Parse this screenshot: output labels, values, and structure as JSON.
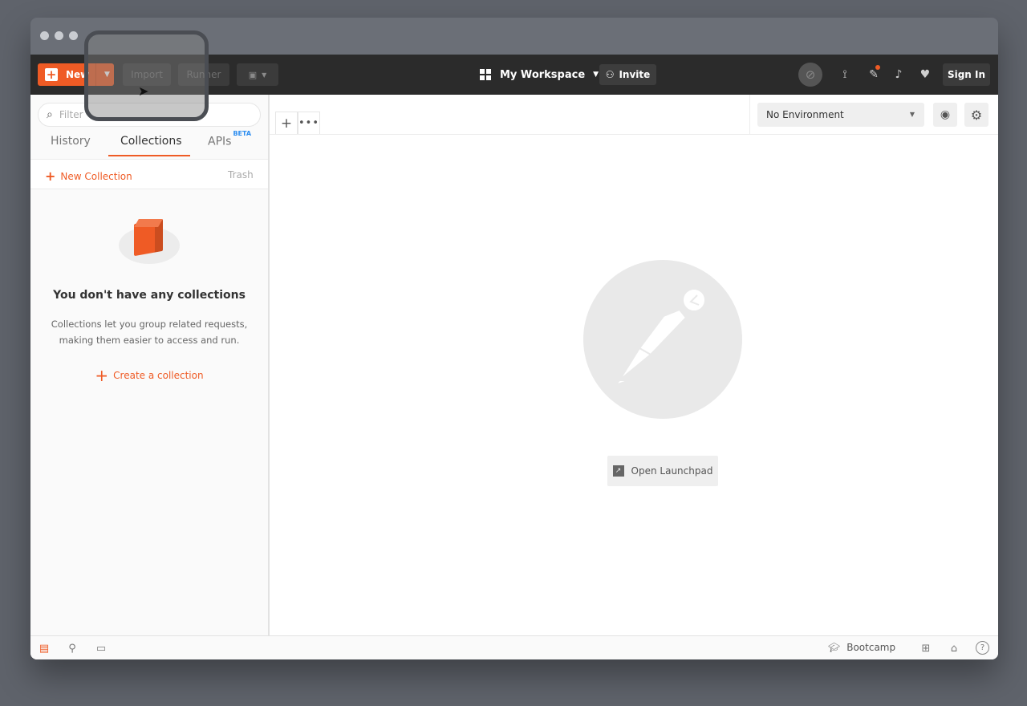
{
  "header": {
    "new_label": "New",
    "import_label": "Import",
    "runner_label": "Runner",
    "workspace_label": "My Workspace",
    "invite_label": "Invite",
    "signin_label": "Sign In"
  },
  "sidebar": {
    "filter_placeholder": "Filter",
    "tabs": [
      {
        "label": "History"
      },
      {
        "label": "Collections"
      },
      {
        "label": "APIs",
        "badge": "BETA"
      }
    ],
    "active_tab": "Collections",
    "new_collection_label": "New Collection",
    "trash_label": "Trash",
    "empty_title": "You don't have any collections",
    "empty_desc_line1": "Collections let you group related requests,",
    "empty_desc_line2": "making them easier to access and run.",
    "create_link": "Create a collection"
  },
  "main": {
    "environment": "No Environment",
    "launchpad_label": "Open Launchpad"
  },
  "footer": {
    "bootcamp_label": "Bootcamp"
  },
  "colors": {
    "accent": "#ef5b25",
    "header_bg": "#2b2b2b",
    "beta_badge": "#2c8df0"
  }
}
